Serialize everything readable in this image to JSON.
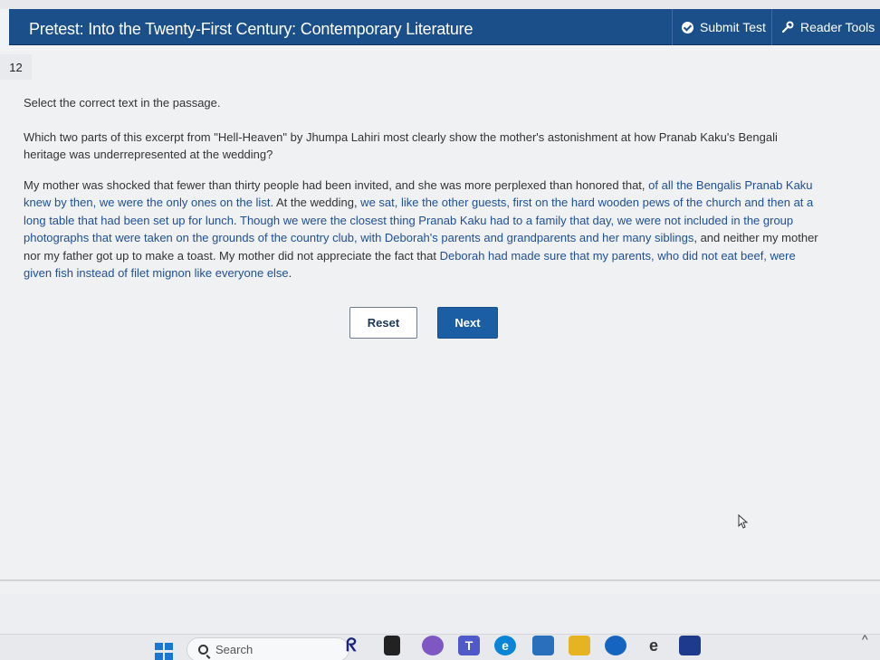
{
  "header": {
    "title": "Pretest: Into the Twenty-First Century: Contemporary Literature",
    "submit_label": "Submit Test",
    "reader_label": "Reader Tools"
  },
  "question_number": "12",
  "instruction": "Select the correct text in the passage.",
  "question": "Which two parts of this excerpt from \"Hell-Heaven\" by Jhumpa Lahiri most clearly show the mother's astonishment at how Pranab Kaku's Bengali heritage was underrepresented at the wedding?",
  "passage": [
    {
      "text": "My mother was shocked that fewer than thirty people had been invited, and she was more perplexed than honored that,",
      "highlight": false
    },
    {
      "text": " of all the Bengalis Pranab Kaku knew by then, we were the only ones on the list",
      "highlight": true
    },
    {
      "text": ". At the wedding,",
      "highlight": false
    },
    {
      "text": " we sat, like the other guests, first on the hard wooden pews of the church and then at a long table that had been set up for lunch",
      "highlight": true
    },
    {
      "text": ". ",
      "highlight": false
    },
    {
      "text": "Though we were the closest thing Pranab Kaku had to a family that day, we were not included in the group photographs that were taken on the grounds of the country club, with Deborah's parents and grandparents and her many siblings",
      "highlight": true
    },
    {
      "text": ", and neither my mother nor my father got up to make a toast. My mother did not appreciate the fact that",
      "highlight": false
    },
    {
      "text": " Deborah had made sure that my parents, who did not eat beef, were given fish instead of filet mignon like everyone else",
      "highlight": true
    },
    {
      "text": ".",
      "highlight": false
    }
  ],
  "buttons": {
    "reset": "Reset",
    "next": "Next"
  },
  "taskbar": {
    "search_placeholder": "Search"
  },
  "colors": {
    "header": "#1b4f8a",
    "accent": "#1b5ea4",
    "highlight_text": "#1f4f96"
  }
}
